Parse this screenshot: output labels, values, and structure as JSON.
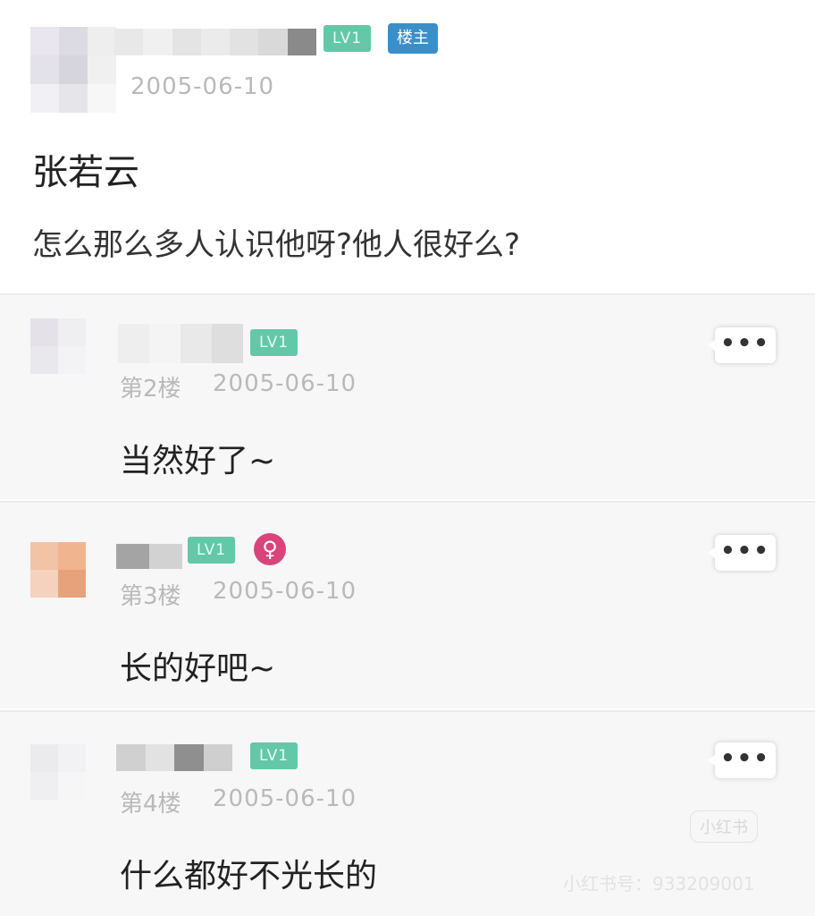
{
  "post": {
    "level_badge": "LV1",
    "owner_badge": "楼主",
    "date": "2005-06-10",
    "title": "张若云",
    "body": "怎么那么多人认识他呀?他人很好么?"
  },
  "replies": [
    {
      "level_badge": "LV1",
      "floor": "第2楼",
      "date": "2005-06-10",
      "text": "当然好了~",
      "more": "•••"
    },
    {
      "level_badge": "LV1",
      "floor": "第3楼",
      "date": "2005-06-10",
      "text": "长的好吧~",
      "more": "•••",
      "gender_symbol": "♀"
    },
    {
      "level_badge": "LV1",
      "floor": "第4楼",
      "date": "2005-06-10",
      "text": "什么都好不光长的",
      "more": "•••"
    }
  ],
  "watermark": {
    "brand": "小红书",
    "id_text": "小红书号：933209001"
  },
  "colors": {
    "level_badge": "#63c8a8",
    "owner_badge": "#3a8fc9",
    "gender_badge": "#d9447a"
  }
}
